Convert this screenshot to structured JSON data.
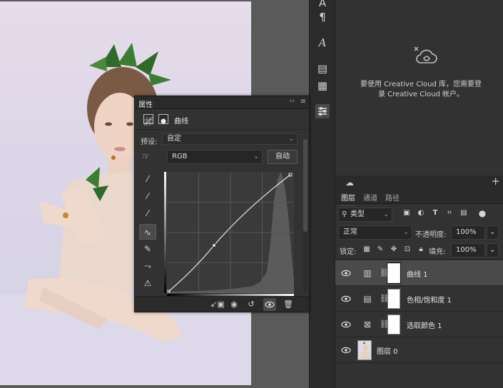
{
  "properties_panel": {
    "title": "属性",
    "collapse_label": "››",
    "menu_label": "≡",
    "adjustment_name": "曲线",
    "preset_label": "预设:",
    "preset_value": "自定",
    "channel_value": "RGB",
    "auto_button": "自动"
  },
  "cc_library": {
    "message": "要使用 Creative Cloud 库，您需要登录 Creative Cloud 帐户。"
  },
  "layers_panel": {
    "tabs": [
      "图层",
      "通道",
      "路径"
    ],
    "filter_type": "类型",
    "blend_mode": "正常",
    "opacity_label": "不透明度:",
    "opacity_value": "100%",
    "lock_label": "锁定:",
    "fill_label": "填充:",
    "fill_value": "100%",
    "layers": [
      {
        "name": "曲线 1",
        "type": "curves",
        "selected": true
      },
      {
        "name": "色相/饱和度 1",
        "type": "hue-saturation",
        "selected": false
      },
      {
        "name": "选取颜色 1",
        "type": "selective-color",
        "selected": false
      },
      {
        "name": "图层 0",
        "type": "pixel",
        "selected": false
      }
    ]
  },
  "colors": {
    "panel_bg": "#323232",
    "selected_layer": "#4a4a4a",
    "canvas_bg": "#5a5a5a"
  }
}
